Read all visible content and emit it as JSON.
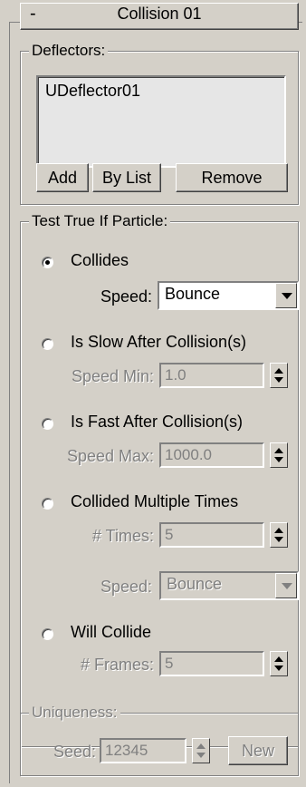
{
  "rollout": {
    "toggle": "-",
    "title": "Collision 01"
  },
  "deflectors": {
    "legend": "Deflectors:",
    "items": [
      "UDeflector01"
    ],
    "add_label": "Add",
    "bylist_label": "By List",
    "remove_label": "Remove"
  },
  "test": {
    "legend": "Test True If Particle:",
    "collides": {
      "label": "Collides",
      "checked": true,
      "speed_label": "Speed:",
      "speed_value": "Bounce"
    },
    "slow": {
      "label": "Is Slow After Collision(s)",
      "checked": false,
      "speed_min_label": "Speed Min:",
      "speed_min_value": "1.0"
    },
    "fast": {
      "label": "Is Fast After Collision(s)",
      "checked": false,
      "speed_max_label": "Speed Max:",
      "speed_max_value": "1000.0"
    },
    "multiple": {
      "label": "Collided Multiple Times",
      "checked": false,
      "times_label": "# Times:",
      "times_value": "5",
      "speed_label": "Speed:",
      "speed_value": "Bounce"
    },
    "will": {
      "label": "Will Collide",
      "checked": false,
      "frames_label": "# Frames:",
      "frames_value": "5"
    }
  },
  "uniqueness": {
    "legend": "Uniqueness:",
    "seed_label": "Seed:",
    "seed_value": "12345",
    "new_label": "New"
  },
  "colors": {
    "panel": "#d4d0c8",
    "disabled_text": "#808080",
    "listbox": "#e6e6e6"
  }
}
